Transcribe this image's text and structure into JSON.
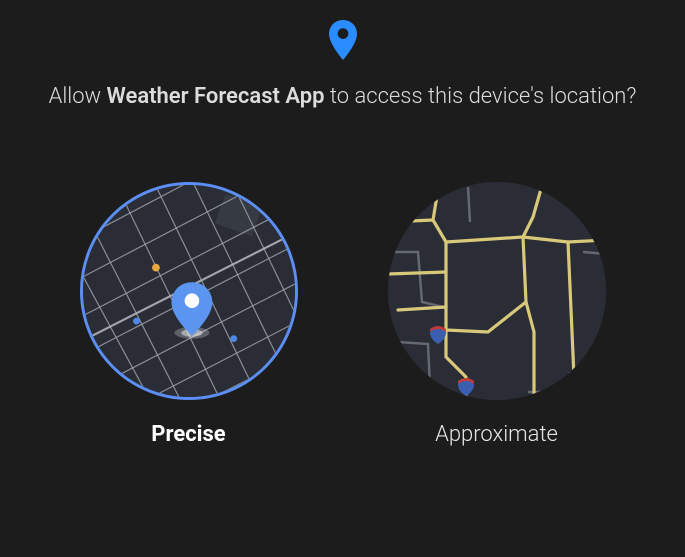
{
  "header_icon": "location-pin-icon",
  "prompt": {
    "prefix": "Allow ",
    "app_name": "Weather Forecast App",
    "suffix": " to access this device's location?"
  },
  "options": {
    "precise": {
      "label": "Precise",
      "selected": true
    },
    "approximate": {
      "label": "Approximate",
      "selected": false
    }
  },
  "colors": {
    "accent": "#2b8cff",
    "accent_light": "#5b8ff5",
    "road_yellow": "#d8c87a",
    "road_grey": "#8f939c",
    "grid_grey": "#a0a3aa",
    "map_bg": "#2a2d36"
  }
}
